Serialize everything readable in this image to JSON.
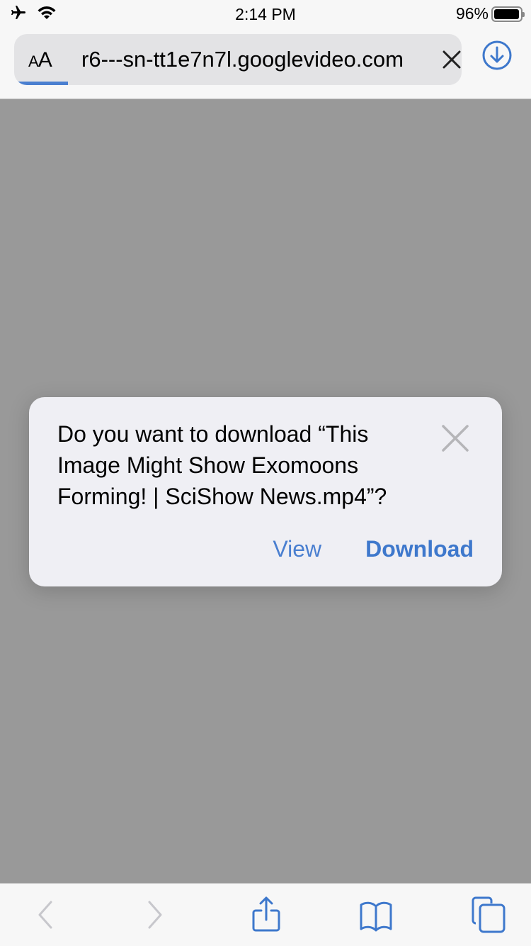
{
  "status_bar": {
    "time": "2:14 PM",
    "battery_percent": "96%",
    "battery_level": 0.96,
    "icons": [
      "airplane-mode-icon",
      "wifi-icon",
      "battery-icon"
    ]
  },
  "address_bar": {
    "reader_button_label_small": "A",
    "reader_button_label_large": "A",
    "url": "r6---sn-tt1e7n7l.googlevideo.com",
    "load_progress": 0.12,
    "icons": [
      "clear-icon",
      "download-icon"
    ]
  },
  "dialog": {
    "message": "Do you want to download “This Image Might Show Exomoons Forming! | SciShow News.mp4”?",
    "view_label": "View",
    "download_label": "Download",
    "icons": [
      "close-icon"
    ]
  },
  "toolbar": {
    "icons": [
      "back-icon",
      "forward-icon",
      "share-icon",
      "bookmarks-icon",
      "tabs-icon"
    ],
    "back_enabled": false,
    "forward_enabled": false
  },
  "colors": {
    "accent": "#3e78cc",
    "disabled": "#c7c7cc",
    "backdrop": "#999999"
  }
}
